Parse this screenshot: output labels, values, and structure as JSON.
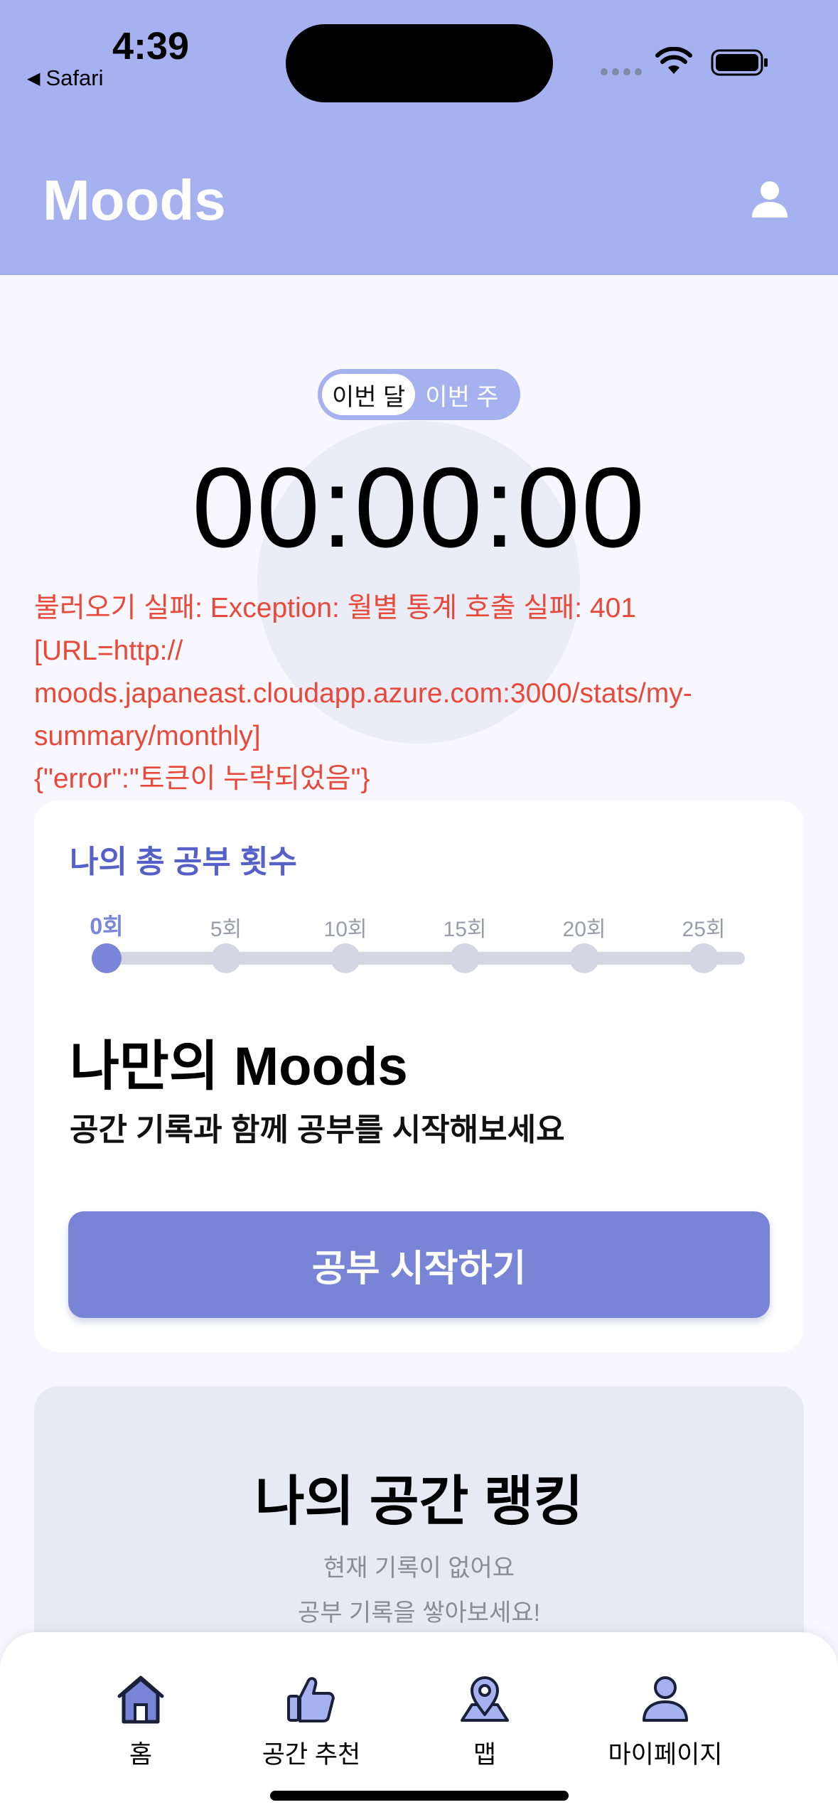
{
  "status_bar": {
    "time": "4:39",
    "back_app": "Safari",
    "icons": [
      "signal-icon",
      "wifi-icon",
      "battery-icon"
    ]
  },
  "header": {
    "title": "Moods",
    "profile_icon": "person-icon",
    "background": "#a6b1f0"
  },
  "period_toggle": {
    "options": [
      "이번 달",
      "이번 주"
    ],
    "selected": "이번 달"
  },
  "timer": {
    "value": "00:00:00"
  },
  "error": {
    "message": "불러오기 실패: Exception: 월별 통계 호출 실패: 401\n[URL=http://\nmoods.japaneast.cloudapp.azure.com:3000/stats/my-\nsummary/monthly]\n{\"error\":\"토큰이 누락되었음\"}",
    "color": "#e8493a"
  },
  "study_card": {
    "title": "나의 총 공부 횟수",
    "progress": {
      "current_count": 0,
      "ticks": [
        "0회",
        "5회",
        "10회",
        "15회",
        "20회",
        "25회"
      ]
    },
    "heading": "나만의 Moods",
    "subheading": "공간 기록과 함께 공부를 시작해보세요",
    "start_button": "공부 시작하기",
    "accent": "#7884d6"
  },
  "ranking_card": {
    "title": "나의 공간 랭킹",
    "empty_line1": "현재 기록이 없어요",
    "empty_line2": "공부 기록을 쌓아보세요!"
  },
  "bottom_nav": {
    "items": [
      {
        "label": "홈",
        "icon": "home-icon"
      },
      {
        "label": "공간 추천",
        "icon": "thumbs-up-icon"
      },
      {
        "label": "맵",
        "icon": "map-pin-icon"
      },
      {
        "label": "마이페이지",
        "icon": "person-icon"
      }
    ]
  }
}
